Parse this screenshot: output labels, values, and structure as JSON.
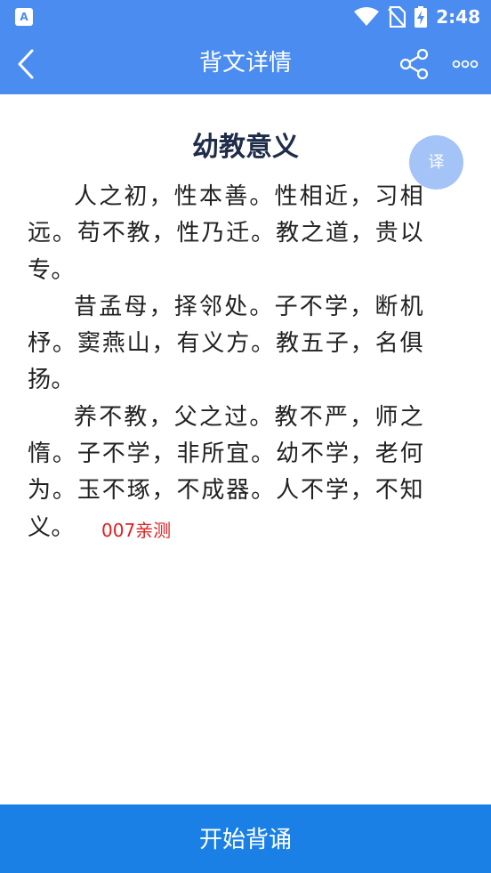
{
  "status_bar": {
    "app_icon_glyph": "A",
    "time": "2:48",
    "icons": [
      "wifi-icon",
      "no-sim-icon",
      "battery-charging-icon"
    ]
  },
  "header": {
    "title": "背文详情",
    "back_icon": "chevron-left-icon",
    "share_icon": "share-icon",
    "more_icon": "more-horizontal-icon"
  },
  "article": {
    "title": "幼教意义",
    "paragraphs": [
      "人之初，性本善。性相近，习相远。苟不教，性乃迁。教之道，贵以专。",
      "昔孟母，择邻处。子不学，断机杼。窦燕山，有义方。教五子，名俱扬。",
      "养不教，父之过。教不严，师之惰。子不学，非所宜。幼不学，老何为。玉不琢，不成器。人不学，不知义。"
    ]
  },
  "translate_button": {
    "label": "译"
  },
  "watermark": "007亲测",
  "footer": {
    "start_label": "开始背诵"
  },
  "colors": {
    "primary": "#4a8cf0",
    "button": "#1a80e5",
    "fab": "#a4c3f7",
    "title_text": "#1f2d4a",
    "watermark": "#e02020"
  }
}
